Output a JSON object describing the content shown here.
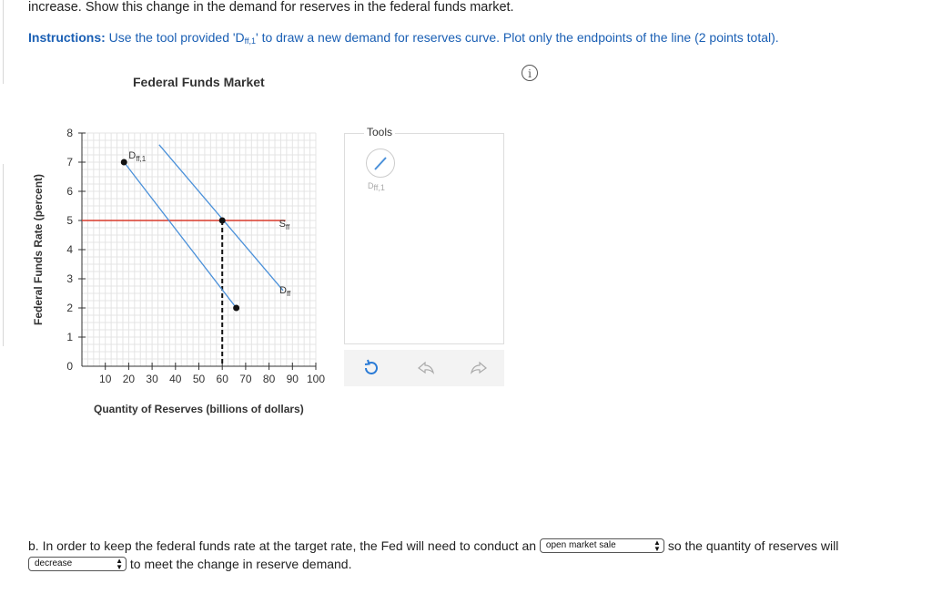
{
  "intro_text": "increase. Show this change in the demand for reserves in the federal funds market.",
  "instructions": {
    "bold": "Instructions:",
    "text_before": " Use the tool provided 'D",
    "sub": "ff,1",
    "text_after": "' to draw a new demand for reserves curve. Plot only the endpoints of the line (2 points total)."
  },
  "info_icon": "i",
  "chart_data": {
    "type": "line",
    "title": "Federal Funds Market",
    "xlabel": "Quantity of Reserves (billions of dollars)",
    "ylabel": "Federal Funds Rate (percent)",
    "xlim": [
      0,
      100
    ],
    "ylim": [
      0,
      8
    ],
    "x_ticks": [
      10,
      20,
      30,
      40,
      50,
      60,
      70,
      80,
      90,
      100
    ],
    "y_ticks": [
      0,
      1,
      2,
      3,
      4,
      5,
      6,
      7,
      8
    ],
    "grid": true,
    "series": [
      {
        "name": "S",
        "sub": "ff",
        "color": "#d93a2b",
        "points": [
          [
            0,
            5
          ],
          [
            87,
            5
          ]
        ]
      },
      {
        "name": "D",
        "sub": "ff",
        "color": "#4a90d9",
        "points": [
          [
            33,
            7.6
          ],
          [
            86,
            2.6
          ]
        ]
      },
      {
        "name": "D",
        "sub": "ff,1",
        "color": "#4a90d9",
        "points": [
          [
            18,
            7
          ],
          [
            66,
            2
          ]
        ],
        "endpoints": true
      }
    ],
    "equilibrium": {
      "x": 60,
      "y": 5
    }
  },
  "tools": {
    "label": "Tools",
    "tool_name": "D",
    "tool_sub": "ff,1"
  },
  "part_b": {
    "text1": "b. In order to keep the federal funds rate at the target rate, the Fed will need to conduct an",
    "select1": "open market sale",
    "text2": "so the quantity of reserves will",
    "select2": "decrease",
    "text3": "to meet the change in reserve demand."
  }
}
